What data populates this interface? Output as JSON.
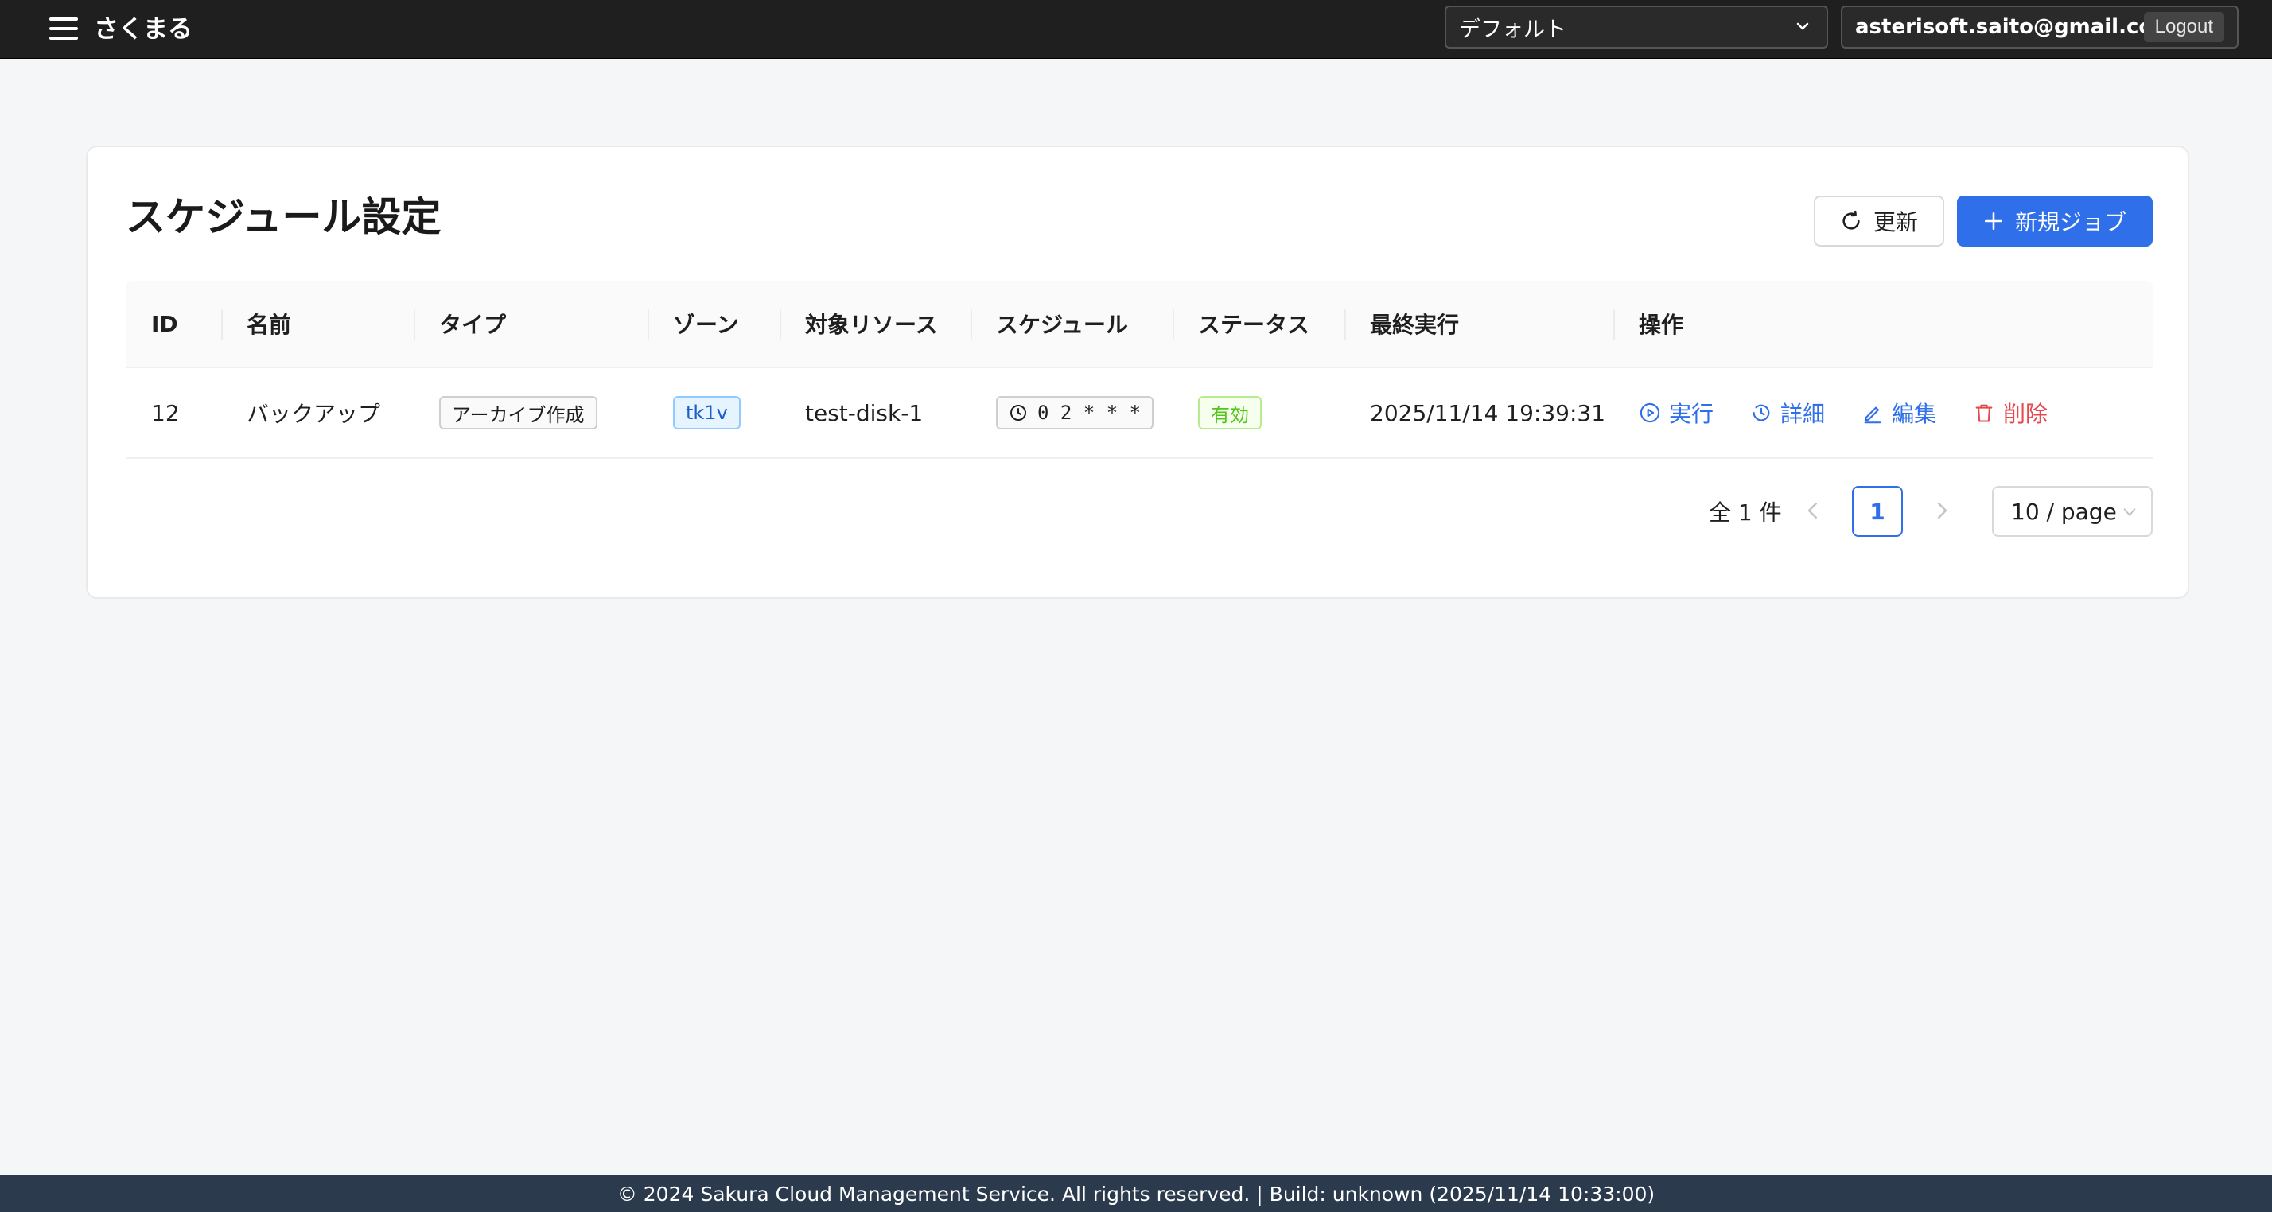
{
  "header": {
    "brand": "さくまる",
    "project_select": "デフォルト",
    "user_email": "asterisoft.saito@gmail.com",
    "logout_label": "Logout"
  },
  "page": {
    "title": "スケジュール設定",
    "refresh_label": "更新",
    "new_job_label": "新規ジョブ"
  },
  "table": {
    "columns": [
      "ID",
      "名前",
      "タイプ",
      "ゾーン",
      "対象リソース",
      "スケジュール",
      "ステータス",
      "最終実行",
      "操作"
    ],
    "rows": [
      {
        "id": "12",
        "name": "バックアップ",
        "type": "アーカイブ作成",
        "zone": "tk1v",
        "resource": "test-disk-1",
        "schedule": "0 2 * * *",
        "status": "有効",
        "last_run": "2025/11/14 19:39:31",
        "actions": {
          "run": "実行",
          "detail": "詳細",
          "edit": "編集",
          "delete": "削除"
        }
      }
    ]
  },
  "pagination": {
    "total": "全 1 件",
    "current_page": "1",
    "page_size": "10 / page"
  },
  "footer": {
    "text": "© 2024 Sakura Cloud Management Service. All rights reserved. | Build: unknown (2025/11/14 10:33:00)"
  },
  "colors": {
    "primary": "#2f6fea",
    "danger": "#e5484d",
    "success": "#52c41a",
    "header_bg": "#1f1f1f",
    "footer_bg": "#2b3a4d"
  }
}
